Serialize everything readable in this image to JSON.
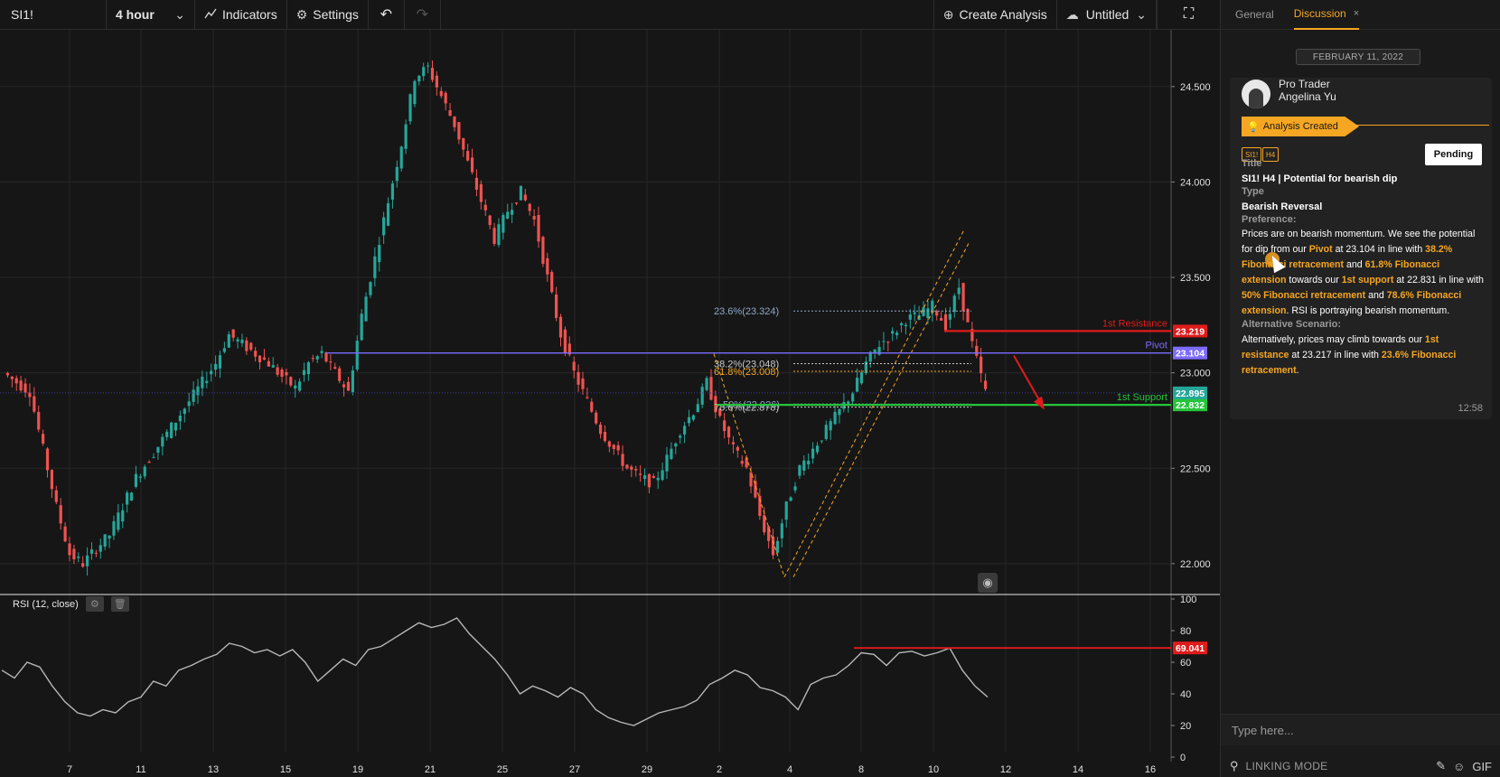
{
  "toolbar": {
    "symbol": "SI1!",
    "interval": "4 hour",
    "indicators_label": "Indicators",
    "settings_label": "Settings",
    "create_analysis_label": "Create Analysis",
    "layout_name": "Untitled"
  },
  "icons": {
    "indicators": "chart-line-icon",
    "settings": "gear-icon",
    "undo": "undo-icon",
    "redo": "redo-icon",
    "create": "plus-circle-icon",
    "layout": "cloud-icon",
    "fullscreen": "fullscreen-icon",
    "idea": "lightbulb-icon"
  },
  "colors": {
    "up": "#26a69a",
    "down": "#ef5350",
    "resistance": "#e01b1b",
    "pivot": "#7c6bff",
    "support": "#25c43a",
    "fib": "#f5a623",
    "accent": "#f5a623"
  },
  "chart_data": {
    "type": "candlestick",
    "symbol": "SI1!",
    "timeframe": "H4",
    "x_ticks": [
      "7",
      "11",
      "13",
      "15",
      "19",
      "21",
      "25",
      "27",
      "29",
      "2",
      "4",
      "8",
      "10",
      "12",
      "14",
      "16"
    ],
    "y_ticks": [
      "24.500",
      "24.000",
      "23.500",
      "23.000",
      "22.500",
      "22.000"
    ],
    "ylim": [
      21.9,
      24.75
    ],
    "close_path": [
      23.0,
      22.95,
      22.9,
      22.6,
      22.3,
      22.05,
      22.0,
      22.08,
      22.15,
      22.3,
      22.45,
      22.55,
      22.65,
      22.75,
      22.85,
      22.95,
      23.05,
      23.2,
      23.15,
      23.1,
      23.05,
      22.98,
      22.92,
      23.05,
      23.1,
      23.0,
      22.9,
      23.3,
      23.6,
      23.9,
      24.2,
      24.55,
      24.6,
      24.45,
      24.3,
      24.1,
      23.9,
      23.7,
      23.85,
      23.95,
      23.8,
      23.5,
      23.2,
      23.0,
      22.85,
      22.7,
      22.6,
      22.5,
      22.45,
      22.42,
      22.55,
      22.7,
      22.8,
      22.95,
      22.75,
      22.6,
      22.5,
      22.25,
      22.05,
      22.3,
      22.5,
      22.6,
      22.7,
      22.8,
      22.9,
      23.05,
      23.15,
      23.2,
      23.28,
      23.3,
      23.35,
      23.25,
      23.45,
      23.15,
      22.9
    ],
    "levels": [
      {
        "label": "1st Resistance",
        "value": 23.219,
        "value_label": "23.219"
      },
      {
        "label": "Pivot",
        "value": 23.104,
        "value_label": "23.104"
      },
      {
        "label": "1st Support",
        "value": 22.832,
        "value_label": "22.832"
      }
    ],
    "current_price": "22.895",
    "fib_labels": [
      {
        "text": "23.6%(23.324)",
        "value": 23.324
      },
      {
        "text": "38.2%(23.048)",
        "value": 23.048
      },
      {
        "text": "61.8%(23.008)",
        "value": 23.008
      },
      {
        "text": "50%(22.926)",
        "value": 22.836
      },
      {
        "text": "78.6%(22.878)",
        "value": 22.82
      }
    ],
    "rsi": {
      "label": "RSI (12, close)",
      "y_ticks": [
        "100",
        "80",
        "60",
        "40",
        "20",
        "0"
      ],
      "ylim": [
        0,
        100
      ],
      "level": 69.041,
      "level_label": "69.041",
      "values": [
        55,
        50,
        60,
        57,
        45,
        35,
        28,
        26,
        30,
        28,
        35,
        38,
        48,
        45,
        55,
        58,
        62,
        65,
        72,
        70,
        66,
        68,
        64,
        68,
        60,
        48,
        55,
        62,
        58,
        68,
        70,
        75,
        80,
        85,
        82,
        84,
        88,
        78,
        70,
        62,
        52,
        40,
        45,
        42,
        38,
        44,
        40,
        30,
        25,
        22,
        20,
        24,
        28,
        30,
        32,
        36,
        46,
        50,
        55,
        52,
        44,
        42,
        38,
        30,
        46,
        50,
        52,
        58,
        66,
        65,
        58,
        66,
        67,
        64,
        66,
        69,
        55,
        45,
        38
      ]
    }
  },
  "panel": {
    "tab_general": "General",
    "tab_discussion": "Discussion",
    "tab_close": "×",
    "date": "FEBRUARY 11, 2022",
    "author_role": "Pro Trader",
    "author_name": "Angelina Yu",
    "status": "Analysis Created",
    "tag_symbol": "SI1!",
    "tag_tf": "H4",
    "pending": "Pending",
    "title_label": "Title",
    "title_value": "SI1! H4 | Potential for bearish dip",
    "type_label": "Type",
    "type_value": "Bearish Reversal",
    "pref_label": "Preference:",
    "alt_label": "Alternative Scenario:",
    "time": "12:58",
    "composer_placeholder": "Type here...",
    "linking_mode": "LINKING MODE",
    "gif": "GIF"
  }
}
